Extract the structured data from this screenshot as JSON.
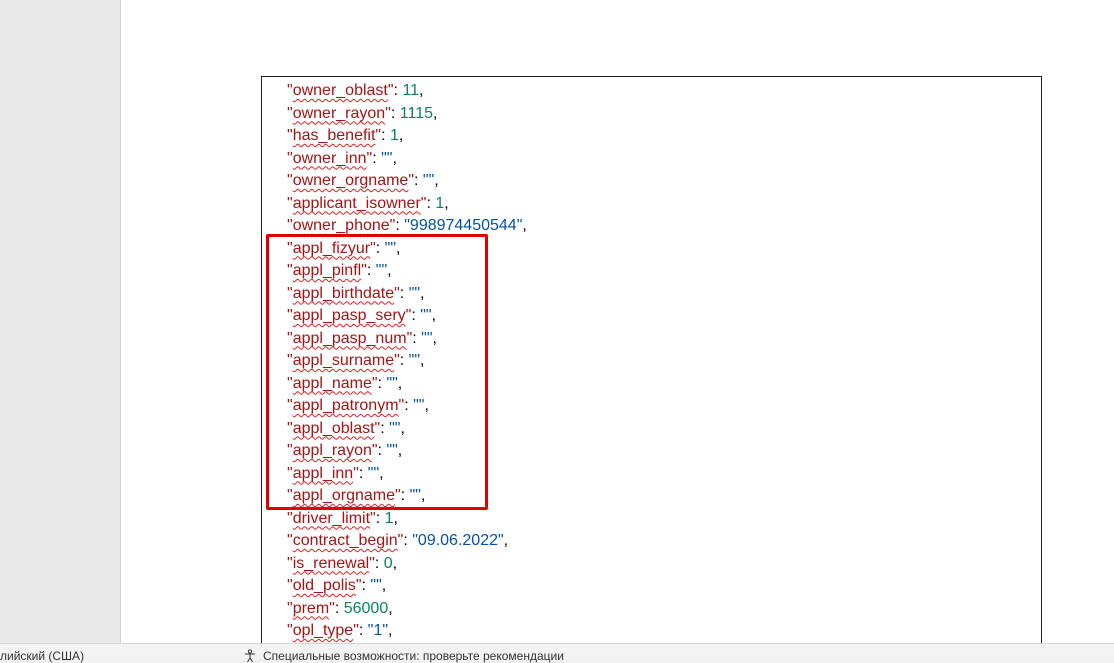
{
  "document": {
    "lines": [
      {
        "key": "owner_oblast",
        "value": "11",
        "type": "number"
      },
      {
        "key": "owner_rayon",
        "value": "1115",
        "type": "number"
      },
      {
        "key": "has_benefit",
        "value": "1",
        "type": "number"
      },
      {
        "key": "owner_inn",
        "value": "\"\"",
        "type": "string"
      },
      {
        "key": "owner_orgname",
        "value": "\"\"",
        "type": "string"
      },
      {
        "key": "applicant_isowner",
        "value": "1",
        "type": "number"
      },
      {
        "key": "owner_phone",
        "value": "\"998974450544\"",
        "type": "string"
      },
      {
        "key": "appl_fizyur",
        "value": "\"\"",
        "type": "string"
      },
      {
        "key": "appl_pinfl",
        "value": "\"\"",
        "type": "string"
      },
      {
        "key": "appl_birthdate",
        "value": "\"\"",
        "type": "string"
      },
      {
        "key": "appl_pasp_sery",
        "value": "\"\"",
        "type": "string"
      },
      {
        "key": "appl_pasp_num",
        "value": "\"\"",
        "type": "string"
      },
      {
        "key": "appl_surname",
        "value": "\"\"",
        "type": "string"
      },
      {
        "key": "appl_name",
        "value": "\"\"",
        "type": "string"
      },
      {
        "key": "appl_patronym",
        "value": "\"\"",
        "type": "string"
      },
      {
        "key": "appl_oblast",
        "value": "\"\"",
        "type": "string"
      },
      {
        "key": "appl_rayon",
        "value": "\"\"",
        "type": "string"
      },
      {
        "key": "appl_inn",
        "value": "\"\"",
        "type": "string"
      },
      {
        "key": "appl_orgname",
        "value": "\"\"",
        "type": "string"
      },
      {
        "key": "driver_limit",
        "value": "1",
        "type": "number"
      },
      {
        "key": "contract_begin",
        "value": "\"09.06.2022\"",
        "type": "string"
      },
      {
        "key": "is_renewal",
        "value": "0",
        "type": "number"
      },
      {
        "key": "old_polis",
        "value": "\"\"",
        "type": "string"
      },
      {
        "key": "prem",
        "value": "56000",
        "type": "number"
      },
      {
        "key": "opl_type",
        "value": "\"1\"",
        "type": "string"
      }
    ],
    "highlight_color": "#e00000"
  },
  "status_bar": {
    "language": "лийский (США)",
    "accessibility": "Специальные возможности: проверьте рекомендации",
    "accessibility_icon": "accessibility-icon"
  },
  "colors": {
    "key": "#a31515",
    "number": "#098658",
    "string": "#0451a5",
    "spellcheck_underline": "#e02020"
  }
}
